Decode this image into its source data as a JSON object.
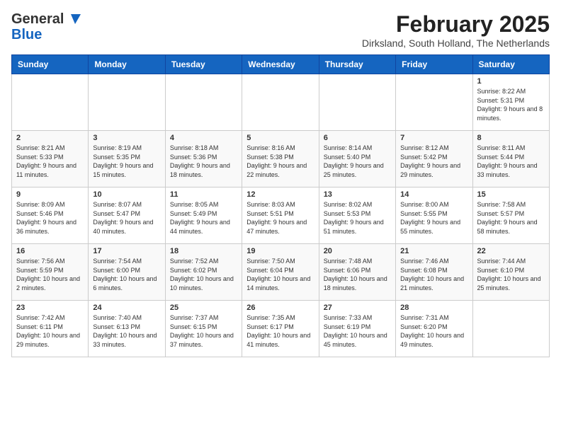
{
  "header": {
    "logo_general": "General",
    "logo_blue": "Blue",
    "month_title": "February 2025",
    "location": "Dirksland, South Holland, The Netherlands"
  },
  "weekdays": [
    "Sunday",
    "Monday",
    "Tuesday",
    "Wednesday",
    "Thursday",
    "Friday",
    "Saturday"
  ],
  "weeks": [
    [
      {
        "day": "",
        "info": ""
      },
      {
        "day": "",
        "info": ""
      },
      {
        "day": "",
        "info": ""
      },
      {
        "day": "",
        "info": ""
      },
      {
        "day": "",
        "info": ""
      },
      {
        "day": "",
        "info": ""
      },
      {
        "day": "1",
        "info": "Sunrise: 8:22 AM\nSunset: 5:31 PM\nDaylight: 9 hours and 8 minutes."
      }
    ],
    [
      {
        "day": "2",
        "info": "Sunrise: 8:21 AM\nSunset: 5:33 PM\nDaylight: 9 hours and 11 minutes."
      },
      {
        "day": "3",
        "info": "Sunrise: 8:19 AM\nSunset: 5:35 PM\nDaylight: 9 hours and 15 minutes."
      },
      {
        "day": "4",
        "info": "Sunrise: 8:18 AM\nSunset: 5:36 PM\nDaylight: 9 hours and 18 minutes."
      },
      {
        "day": "5",
        "info": "Sunrise: 8:16 AM\nSunset: 5:38 PM\nDaylight: 9 hours and 22 minutes."
      },
      {
        "day": "6",
        "info": "Sunrise: 8:14 AM\nSunset: 5:40 PM\nDaylight: 9 hours and 25 minutes."
      },
      {
        "day": "7",
        "info": "Sunrise: 8:12 AM\nSunset: 5:42 PM\nDaylight: 9 hours and 29 minutes."
      },
      {
        "day": "8",
        "info": "Sunrise: 8:11 AM\nSunset: 5:44 PM\nDaylight: 9 hours and 33 minutes."
      }
    ],
    [
      {
        "day": "9",
        "info": "Sunrise: 8:09 AM\nSunset: 5:46 PM\nDaylight: 9 hours and 36 minutes."
      },
      {
        "day": "10",
        "info": "Sunrise: 8:07 AM\nSunset: 5:47 PM\nDaylight: 9 hours and 40 minutes."
      },
      {
        "day": "11",
        "info": "Sunrise: 8:05 AM\nSunset: 5:49 PM\nDaylight: 9 hours and 44 minutes."
      },
      {
        "day": "12",
        "info": "Sunrise: 8:03 AM\nSunset: 5:51 PM\nDaylight: 9 hours and 47 minutes."
      },
      {
        "day": "13",
        "info": "Sunrise: 8:02 AM\nSunset: 5:53 PM\nDaylight: 9 hours and 51 minutes."
      },
      {
        "day": "14",
        "info": "Sunrise: 8:00 AM\nSunset: 5:55 PM\nDaylight: 9 hours and 55 minutes."
      },
      {
        "day": "15",
        "info": "Sunrise: 7:58 AM\nSunset: 5:57 PM\nDaylight: 9 hours and 58 minutes."
      }
    ],
    [
      {
        "day": "16",
        "info": "Sunrise: 7:56 AM\nSunset: 5:59 PM\nDaylight: 10 hours and 2 minutes."
      },
      {
        "day": "17",
        "info": "Sunrise: 7:54 AM\nSunset: 6:00 PM\nDaylight: 10 hours and 6 minutes."
      },
      {
        "day": "18",
        "info": "Sunrise: 7:52 AM\nSunset: 6:02 PM\nDaylight: 10 hours and 10 minutes."
      },
      {
        "day": "19",
        "info": "Sunrise: 7:50 AM\nSunset: 6:04 PM\nDaylight: 10 hours and 14 minutes."
      },
      {
        "day": "20",
        "info": "Sunrise: 7:48 AM\nSunset: 6:06 PM\nDaylight: 10 hours and 18 minutes."
      },
      {
        "day": "21",
        "info": "Sunrise: 7:46 AM\nSunset: 6:08 PM\nDaylight: 10 hours and 21 minutes."
      },
      {
        "day": "22",
        "info": "Sunrise: 7:44 AM\nSunset: 6:10 PM\nDaylight: 10 hours and 25 minutes."
      }
    ],
    [
      {
        "day": "23",
        "info": "Sunrise: 7:42 AM\nSunset: 6:11 PM\nDaylight: 10 hours and 29 minutes."
      },
      {
        "day": "24",
        "info": "Sunrise: 7:40 AM\nSunset: 6:13 PM\nDaylight: 10 hours and 33 minutes."
      },
      {
        "day": "25",
        "info": "Sunrise: 7:37 AM\nSunset: 6:15 PM\nDaylight: 10 hours and 37 minutes."
      },
      {
        "day": "26",
        "info": "Sunrise: 7:35 AM\nSunset: 6:17 PM\nDaylight: 10 hours and 41 minutes."
      },
      {
        "day": "27",
        "info": "Sunrise: 7:33 AM\nSunset: 6:19 PM\nDaylight: 10 hours and 45 minutes."
      },
      {
        "day": "28",
        "info": "Sunrise: 7:31 AM\nSunset: 6:20 PM\nDaylight: 10 hours and 49 minutes."
      },
      {
        "day": "",
        "info": ""
      }
    ]
  ]
}
